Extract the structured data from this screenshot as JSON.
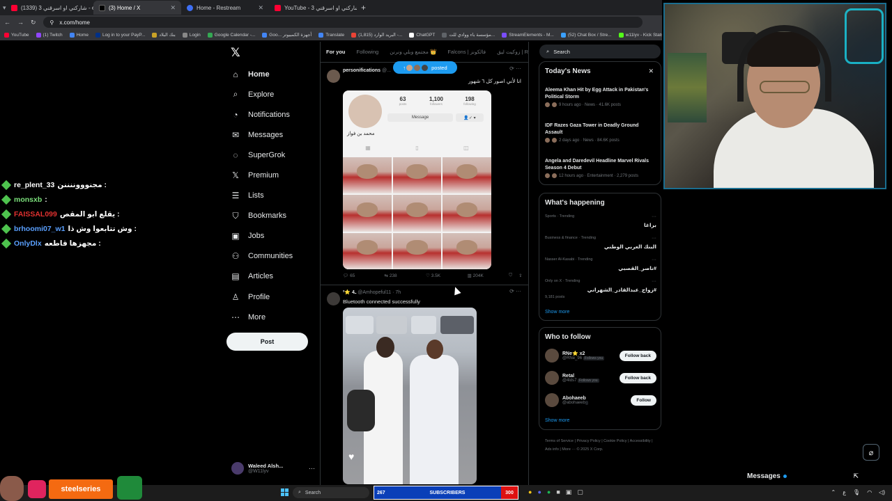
{
  "browser": {
    "tabs": [
      {
        "label": "(1339) شاركني او اسرقني 3 - e",
        "favicon": "#ff0033",
        "active": false
      },
      {
        "label": "(3) Home / X",
        "favicon": "#000000",
        "active": true
      },
      {
        "label": "Home - Restream",
        "favicon": "#3e6ff4",
        "active": false
      },
      {
        "label": "YouTube - شاركني او اسرقني 3",
        "favicon": "#ff0033",
        "active": false
      }
    ],
    "url": "x.com/home",
    "bookmarks": [
      {
        "label": "YouTube",
        "color": "#ff0033"
      },
      {
        "label": "(1) Twitch",
        "color": "#9146ff"
      },
      {
        "label": "Home",
        "color": "#4285f4"
      },
      {
        "label": "Log in to your PayP...",
        "color": "#003087"
      },
      {
        "label": "بنك البلاد",
        "color": "#c9a227"
      },
      {
        "label": "Login",
        "color": "#888888"
      },
      {
        "label": "Google Calendar -...",
        "color": "#34a853"
      },
      {
        "label": "Goo... أجهزة الكمبيوتر",
        "color": "#4285f4"
      },
      {
        "label": "Translate",
        "color": "#4285f4"
      },
      {
        "label": "(1,815) البريد الوارد -...",
        "color": "#ea4335"
      },
      {
        "label": "ChatGPT",
        "color": "#ffffff"
      },
      {
        "label": "مؤسسة باء ووادي للت...",
        "color": "#5f6368"
      },
      {
        "label": "StreamElements - M...",
        "color": "#7b4dff"
      },
      {
        "label": "(52) Chat Box / Stre...",
        "color": "#3aa0ff"
      },
      {
        "label": "w11lyv - Kick Stats...",
        "color": "#53fc18"
      },
      {
        "label": "Kick",
        "color": "#53fc18"
      }
    ]
  },
  "x": {
    "nav": [
      {
        "label": "Home",
        "icon": "home-icon",
        "glyph": "⌂",
        "bold": true
      },
      {
        "label": "Explore",
        "icon": "search-icon",
        "glyph": "⌕"
      },
      {
        "label": "Notifications",
        "icon": "bell-icon",
        "glyph": "◔"
      },
      {
        "label": "Messages",
        "icon": "mail-icon",
        "glyph": "✉"
      },
      {
        "label": "SuperGrok",
        "icon": "grok-icon",
        "glyph": "◌"
      },
      {
        "label": "Premium",
        "icon": "x-icon",
        "glyph": "𝕏"
      },
      {
        "label": "Lists",
        "icon": "list-icon",
        "glyph": "☰"
      },
      {
        "label": "Bookmarks",
        "icon": "bookmark-icon",
        "glyph": "⛉"
      },
      {
        "label": "Jobs",
        "icon": "briefcase-icon",
        "glyph": "▣"
      },
      {
        "label": "Communities",
        "icon": "people-icon",
        "glyph": "⚇"
      },
      {
        "label": "Articles",
        "icon": "article-icon",
        "glyph": "▤"
      },
      {
        "label": "Profile",
        "icon": "person-icon",
        "glyph": "♙"
      },
      {
        "label": "More",
        "icon": "more-icon",
        "glyph": "⋯"
      }
    ],
    "post_button": "Post",
    "account": {
      "name": "Waleed Alsh...",
      "handle": "@W11lyv"
    },
    "timeline_tabs": [
      "For you",
      "Following",
      "مجتمع وبلي ونرنن 👑",
      "Falcons | فالكونز",
      "زوكيت ليق | RL"
    ],
    "posted_pill": "posted",
    "posts": [
      {
        "author": "personifications",
        "handle": "@...",
        "text": "انا لأني اصور كل ٦ شهور",
        "profile": {
          "posts": "63",
          "followers": "1,100",
          "following": "198",
          "posts_label": "posts",
          "followers_label": "followers",
          "following_label": "following",
          "message": "Message",
          "name": "محمد بن فواز"
        },
        "stats": {
          "replies": "65",
          "reposts": "238",
          "likes": "3.5K",
          "views": "204K"
        }
      },
      {
        "author": "ـ4 ⭐²",
        "handle": "@Amhopeful11 · 7h",
        "text": "Bluetooth connected successfully"
      }
    ],
    "search_placeholder": "Search",
    "today_news": {
      "title": "Today's News",
      "items": [
        {
          "title": "Aleema Khan Hit by Egg Attack in Pakistan's Political Storm",
          "meta": "9 hours ago · News · 41.6K posts"
        },
        {
          "title": "IDF Razes Gaza Tower in Deadly Ground Assault",
          "meta": "2 days ago · News · 84.6K posts"
        },
        {
          "title": "Angela and Daredevil Headline Marvel Rivals Season 4 Debut",
          "meta": "12 hours ago · Entertainment · 2,279 posts"
        }
      ]
    },
    "whats_happening": {
      "title": "What's happening",
      "items": [
        {
          "category": "Sports · Trending",
          "name": "براغا"
        },
        {
          "category": "Business & finance · Trending",
          "name": "البنك العربي الوطني"
        },
        {
          "category": "Nasser Al-Kasabi · Trending",
          "name": "#ناصر_القصبي"
        },
        {
          "category": "Only on X · Trending",
          "name": "#زواج_عبدالقادر_الشهراني",
          "posts": "9,181 posts"
        }
      ],
      "show_more": "Show more"
    },
    "who_to_follow": {
      "title": "Who to follow",
      "users": [
        {
          "name": "RNe⭐ x2",
          "handle": "@RNe_96",
          "badge": "Follows you",
          "button": "Follow back"
        },
        {
          "name": "Retal",
          "handle": "@4lds7",
          "badge": "Follows you",
          "button": "Follow back"
        },
        {
          "name": "Abohaeeb",
          "handle": "@abohaeeb",
          "badge": "",
          "button": "Follow"
        }
      ],
      "show_more": "Show more"
    },
    "footer": "Terms of Service  |  Privacy Policy  |  Cookie Policy  |  Accessibility  |  Ads info  |  More ···  © 2025 X Corp.",
    "messages_label": "Messages"
  },
  "stream": {
    "chat": [
      {
        "user": "re_plent_33",
        "color": "#ffffff",
        "message": ": مجنوووننننن"
      },
      {
        "user": "monsxb",
        "color": "#7be07b",
        "message": ":"
      },
      {
        "user": "FAISSAL099",
        "color": "#e0312f",
        "message": ": يقلع ابو المقص"
      },
      {
        "user": "brhoomi07_w1",
        "color": "#5aa0ff",
        "message": ": وش تتابعوا وش ذا"
      },
      {
        "user": "OnlyDlx",
        "color": "#5aa0ff",
        "message": ": مجهزها قاطعه"
      }
    ],
    "sponsor": "steelseries",
    "subscribers": {
      "left": "267",
      "label": "SUBSCRIBERS",
      "right": "300"
    }
  },
  "taskbar": {
    "search_placeholder": "Search",
    "lang": "ع"
  }
}
